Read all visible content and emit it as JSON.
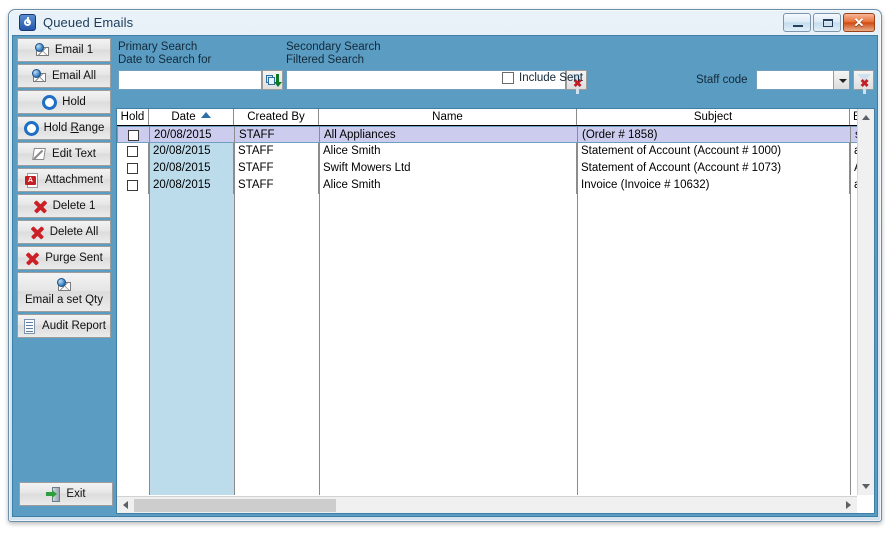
{
  "window": {
    "title": "Queued Emails",
    "icon": "power-button-icon",
    "buttons": {
      "minimize": "minimize",
      "maximize": "maximize",
      "close": "close"
    }
  },
  "sidebar": {
    "items": [
      {
        "label": "Email 1",
        "icon": "email-globe-icon"
      },
      {
        "label": "Email All",
        "icon": "email-globe-icon"
      },
      {
        "label": "Hold",
        "icon": "blue-ring-icon"
      },
      {
        "label": "Hold Range",
        "icon": "blue-ring-icon",
        "accel": "R"
      },
      {
        "label": "Edit Text",
        "icon": "edit-pencil-icon"
      },
      {
        "label": "Attachment",
        "icon": "pdf-icon"
      },
      {
        "label": "Delete 1",
        "icon": "red-x-icon"
      },
      {
        "label": "Delete All",
        "icon": "red-x-icon"
      },
      {
        "label": "Purge Sent",
        "icon": "red-x-icon"
      },
      {
        "label": "Email a set Qty",
        "icon": "email-globe-icon"
      },
      {
        "label": "Audit Report",
        "icon": "document-icon"
      }
    ],
    "exit": {
      "label": "Exit",
      "icon": "exit-door-icon"
    }
  },
  "search": {
    "primary_title": "Primary Search",
    "primary_subtitle": "Date to Search for",
    "primary_value": "",
    "primary_button_icon": "copy-down-icon",
    "secondary_title": "Secondary Search",
    "secondary_subtitle": "Filtered Search",
    "secondary_value": "",
    "secondary_button_icon": "clear-filter-icon",
    "include_sent_label": "Include Sent",
    "include_sent_checked": false,
    "staff_code_label": "Staff code",
    "staff_code_value": "",
    "staff_code_button_icon": "clear-filter-icon"
  },
  "grid": {
    "columns": [
      {
        "key": "hold",
        "label": "Hold"
      },
      {
        "key": "date",
        "label": "Date",
        "sorted": "asc",
        "sort_icon": "sort-ascending-icon"
      },
      {
        "key": "created_by",
        "label": "Created By"
      },
      {
        "key": "name",
        "label": "Name"
      },
      {
        "key": "subject",
        "label": "Subject"
      },
      {
        "key": "email",
        "label": "E"
      }
    ],
    "rows": [
      {
        "hold": false,
        "date": "20/08/2015",
        "created_by": "STAFF",
        "name": "All Appliances",
        "subject": " (Order # 1858)",
        "email": "s",
        "selected": true
      },
      {
        "hold": false,
        "date": "20/08/2015",
        "created_by": "STAFF",
        "name": "Alice Smith",
        "subject": "Statement of Account (Account # 1000)",
        "email": "a",
        "selected": false
      },
      {
        "hold": false,
        "date": "20/08/2015",
        "created_by": "STAFF",
        "name": "Swift Mowers Ltd",
        "subject": "Statement of Account (Account # 1073)",
        "email": "A",
        "selected": false
      },
      {
        "hold": false,
        "date": "20/08/2015",
        "created_by": "STAFF",
        "name": "Alice Smith",
        "subject": "Invoice (Invoice # 10632)",
        "email": "a",
        "selected": false
      }
    ],
    "scrollbars": {
      "vertical_up": "scroll-up-icon",
      "vertical_down": "scroll-down-icon",
      "horizontal_left": "scroll-left-icon",
      "horizontal_right": "scroll-right-icon"
    }
  },
  "colors": {
    "panel_blue": "#5b9cc2",
    "selected_row": "#ccccee",
    "sorted_column": "#bcdcec",
    "accent": "#2f6fa8"
  }
}
